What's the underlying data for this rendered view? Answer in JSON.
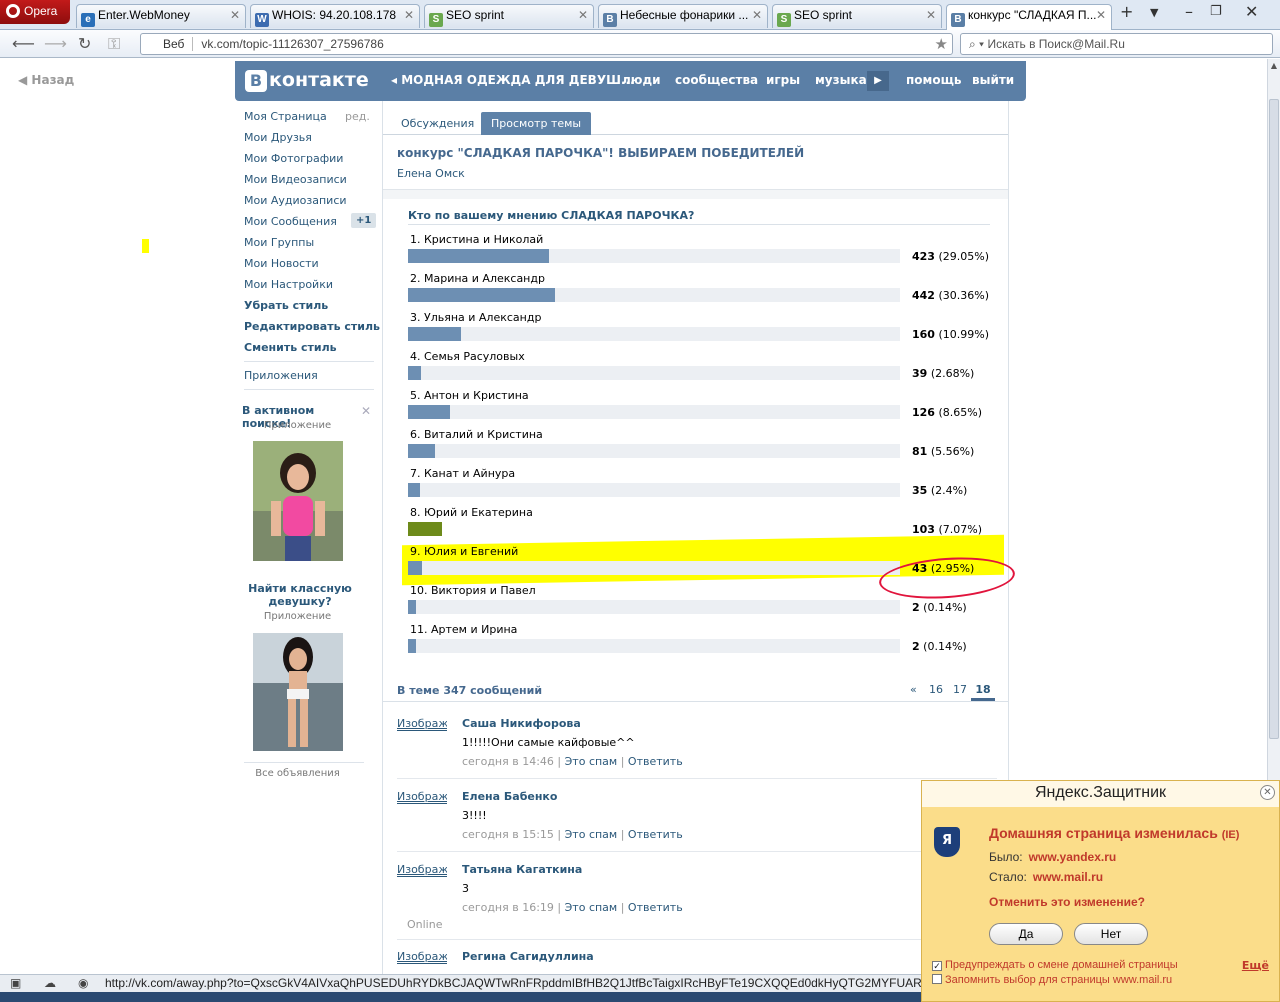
{
  "browser": {
    "menu_label": "Opera",
    "tabs": [
      {
        "label": "Enter.WebMoney",
        "icon": "webmoney-icon"
      },
      {
        "label": "WHOIS: 94.20.108.178",
        "icon": "whois-icon"
      },
      {
        "label": "SEO sprint",
        "icon": "seosprint-icon"
      },
      {
        "label": "Небесные фонарики ...",
        "icon": "vk-icon"
      },
      {
        "label": "SEO sprint",
        "icon": "seosprint-icon"
      },
      {
        "label": "конкурс \"СЛАДКАЯ П...",
        "icon": "vk-icon"
      }
    ],
    "web_label": "Веб",
    "url": "vk.com/topic-11126307_27596786",
    "search_placeholder": "Искать в Поиск@Mail.Ru",
    "status_url": "http://vk.com/away.php?to=QxscGkV4AIVxaQhPUSEDUhRYDkBCJAQWTwRnFRpddmIBfHB2Q1JtfBcTaigxIRcHByFTe19CXQQEd0dkHyQTG2MYFUARDno7M"
  },
  "vk": {
    "back_label": "Назад",
    "logo_text": "контакте",
    "logo_letter": "В",
    "group_nav": "МОДНАЯ ОДЕЖДА ДЛЯ ДЕВУШ...",
    "nav": [
      "люди",
      "сообщества",
      "игры",
      "музыка",
      "помощь",
      "выйти"
    ],
    "left_menu": {
      "edit_label": "ред.",
      "items": [
        "Моя Страница",
        "Мои Друзья",
        "Мои Фотографии",
        "Мои Видеозаписи",
        "Мои Аудиозаписи",
        "Мои Сообщения",
        "Мои Группы",
        "Мои Новости",
        "Мои Настройки"
      ],
      "messages_badge": "+1",
      "style_items": [
        "Убрать стиль",
        "Редактировать стиль",
        "Сменить стиль"
      ],
      "apps": "Приложения"
    },
    "ads": [
      {
        "title": "В активном поиске!",
        "sub": "Приложение"
      },
      {
        "title": "Найти классную девушку?",
        "sub": "Приложение"
      }
    ],
    "all_ads": "Все объявления",
    "tabs": [
      "Обсуждения",
      "Просмотр темы"
    ],
    "topic_title": "конкурс \"СЛАДКАЯ ПАРОЧКА\"! ВЫБИРАЕМ ПОБЕДИТЕЛЕЙ",
    "topic_author": "Елена Омск",
    "poll": {
      "question": "Кто по вашему мнению СЛАДКАЯ ПАРОЧКА?",
      "options": [
        {
          "label": "1. Кристина и Николай",
          "count": "423",
          "pct": "(29.05%)",
          "share": 29.05
        },
        {
          "label": "2. Марина и Александр",
          "count": "442",
          "pct": "(30.36%)",
          "share": 30.36
        },
        {
          "label": "3. Ульяна и Александр",
          "count": "160",
          "pct": "(10.99%)",
          "share": 10.99
        },
        {
          "label": "4. Семья Расуловых",
          "count": "39",
          "pct": "(2.68%)",
          "share": 2.68
        },
        {
          "label": "5. Антон и Кристина",
          "count": "126",
          "pct": "(8.65%)",
          "share": 8.65
        },
        {
          "label": "6. Виталий и Кристина",
          "count": "81",
          "pct": "(5.56%)",
          "share": 5.56
        },
        {
          "label": "7. Канат и Айнура",
          "count": "35",
          "pct": "(2.4%)",
          "share": 2.4
        },
        {
          "label": "8. Юрий и Екатерина",
          "count": "103",
          "pct": "(7.07%)",
          "share": 7.07
        },
        {
          "label": "9. Юлия и Евгений",
          "count": "43",
          "pct": "(2.95%)",
          "share": 2.95
        },
        {
          "label": "10. Виктория и Павел",
          "count": "2",
          "pct": "(0.14%)",
          "share": 0.14
        },
        {
          "label": "11. Артем и Ирина",
          "count": "2",
          "pct": "(0.14%)",
          "share": 0.14
        }
      ]
    },
    "posts_count": "В теме 347 сообщений",
    "pager": [
      "«",
      "16",
      "17",
      "18"
    ],
    "posts": [
      {
        "avatar": "Изображе",
        "name": "Саша Никифорова",
        "text": "1!!!!!Они самые кайфовые^^",
        "time": "сегодня в 14:46",
        "spam": "Это спам",
        "reply": "Ответить"
      },
      {
        "avatar": "Изображе",
        "name": "Елена Бабенко",
        "text": "3!!!!",
        "time": "сегодня в 15:15",
        "spam": "Это спам",
        "reply": "Ответить"
      },
      {
        "avatar": "Изображе",
        "name": "Татьяна Кагаткина",
        "text": "3",
        "time": "сегодня в 16:19",
        "spam": "Это спам",
        "reply": "Ответить"
      },
      {
        "avatar": "Изображе",
        "name": "Регина Сагидуллина"
      }
    ],
    "online": "Online"
  },
  "yandex": {
    "title": "Яндекс.Защитник",
    "heading": "Домашняя страница изменилась",
    "heading_tag": "(IE)",
    "was_label": "Было:",
    "was_value": "www.yandex.ru",
    "now_label": "Стало:",
    "now_value": "www.mail.ru",
    "undo": "Отменить это изменение?",
    "yes": "Да",
    "no": "Нет",
    "warn_check": "Предупреждать о смене домашней страницы",
    "remember_check": "Запомнить выбор для страницы www.mail.ru",
    "more": "Ещё"
  },
  "colors": {
    "vk_blue": "#5b7fa6",
    "highlight": "#ffff00",
    "yandex_bg": "#fbdd8a",
    "yandex_red": "#c0392b"
  }
}
